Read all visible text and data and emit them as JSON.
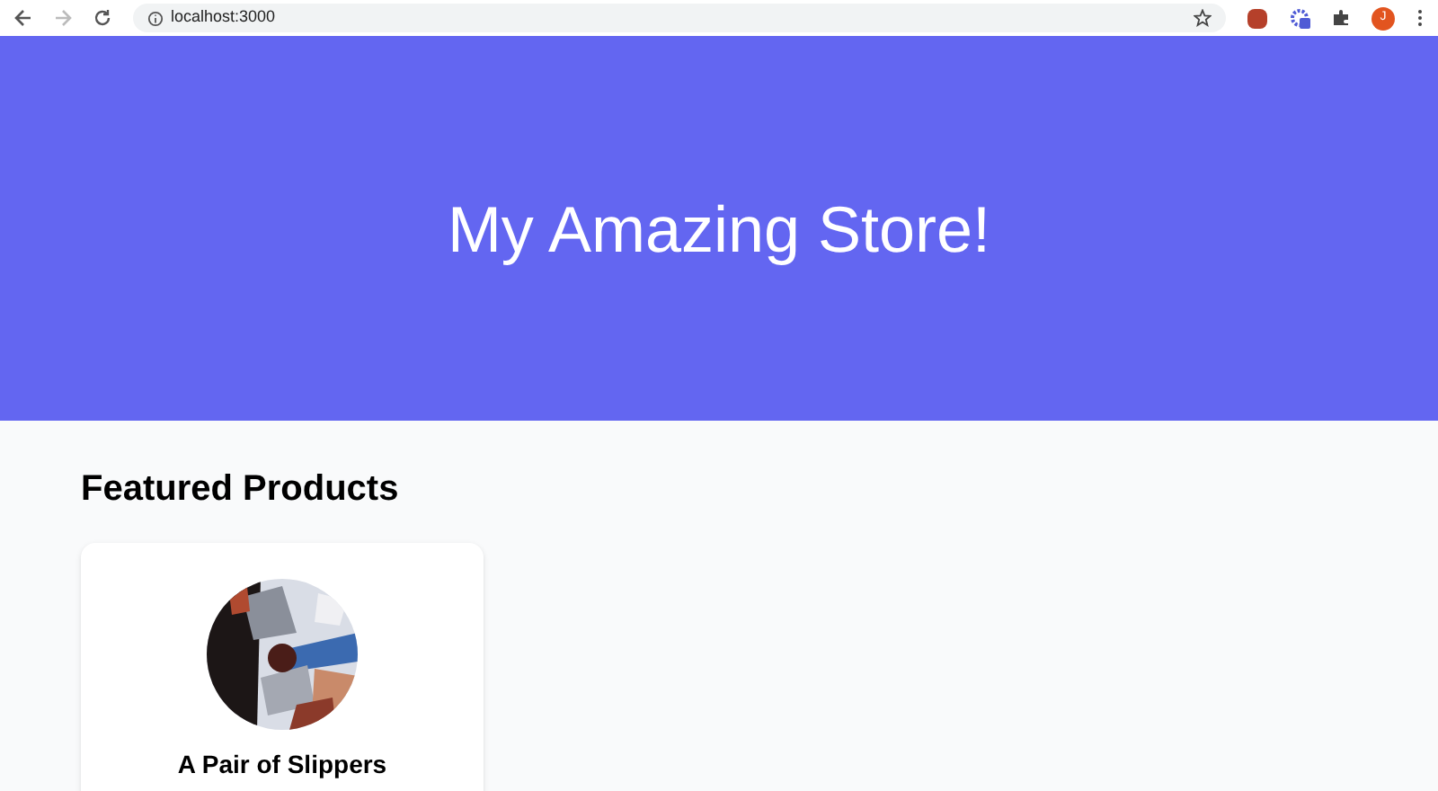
{
  "browser": {
    "address": "localhost:3000",
    "profile_initial": "J"
  },
  "hero": {
    "title": "My Amazing Store!"
  },
  "featured": {
    "heading": "Featured Products",
    "products": [
      {
        "name": "A Pair of Slippers"
      }
    ]
  }
}
